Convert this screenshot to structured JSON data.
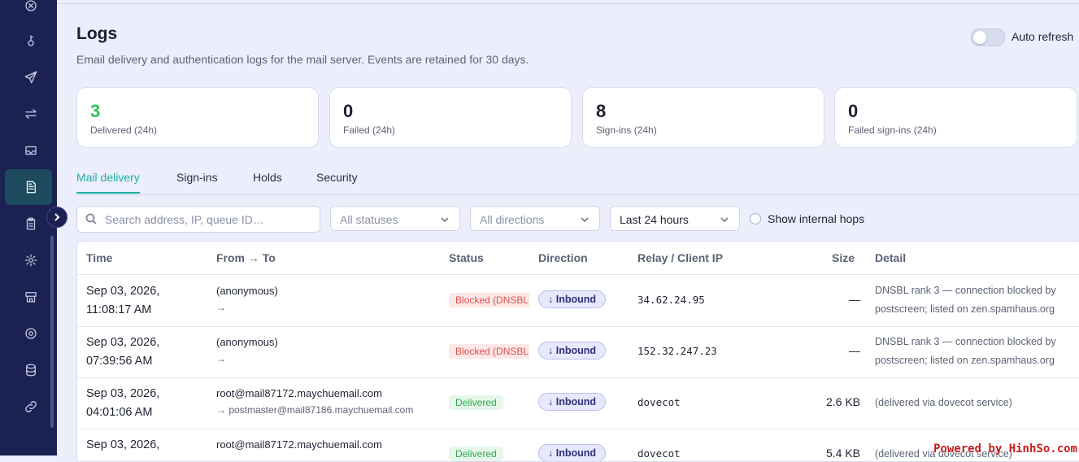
{
  "sidebar": {
    "icons": [
      "close-circle-icon",
      "key-icon",
      "send-icon",
      "swap-arrows-icon",
      "inbox-tray-icon",
      "document-icon",
      "clipboard-icon",
      "gear-icon",
      "store-icon",
      "settings-cog-icon",
      "database-icon",
      "link-icon"
    ],
    "active": "document-icon"
  },
  "header": {
    "title": "Logs",
    "subtitle": "Email delivery and authentication logs for the mail server. Events are retained for 30 days.",
    "auto_refresh_label": "Auto refresh",
    "auto_refresh_on": false
  },
  "stats": [
    {
      "value": "3",
      "label": "Delivered (24h)",
      "color": "#2fbf5b"
    },
    {
      "value": "0",
      "label": "Failed (24h)"
    },
    {
      "value": "8",
      "label": "Sign-ins (24h)"
    },
    {
      "value": "0",
      "label": "Failed sign-ins (24h)"
    }
  ],
  "tabs": [
    {
      "label": "Mail delivery",
      "active": true
    },
    {
      "label": "Sign-ins"
    },
    {
      "label": "Holds"
    },
    {
      "label": "Security"
    }
  ],
  "filters": {
    "search_placeholder": "Search address, IP, queue ID…",
    "status": "All statuses",
    "direction": "All directions",
    "range": "Last 24 hours",
    "show_internal_hops": "Show internal hops"
  },
  "table": {
    "columns": [
      "Time",
      "From → To",
      "Status",
      "Direction",
      "Relay / Client IP",
      "Size",
      "Detail"
    ],
    "rows": [
      {
        "date": "Sep 03, 2026,",
        "time": "11:08:17 AM",
        "from": "(anonymous)",
        "to": "→",
        "status": "Blocked (DNSBL",
        "direction": "↓ Inbound",
        "relay": "34.62.24.95",
        "size": "—",
        "detail": "DNSBL rank 3 — connection blocked by postscreen; listed on zen.spamhaus.org"
      },
      {
        "date": "Sep 03, 2026,",
        "time": "07:39:56 AM",
        "from": "(anonymous)",
        "to": "→",
        "status": "Blocked (DNSBL",
        "direction": "↓ Inbound",
        "relay": "152.32.247.23",
        "size": "—",
        "detail": "DNSBL rank 3 — connection blocked by postscreen; listed on zen.spamhaus.org"
      },
      {
        "date": "Sep 03, 2026,",
        "time": "04:01:06 AM",
        "from": "root@mail87172.maychuemail.com",
        "to": "→ postmaster@mail87186.maychuemail.com",
        "status": "Delivered",
        "direction": "↓ Inbound",
        "relay": "dovecot",
        "size": "2.6 KB",
        "detail": "(delivered via dovecot service)"
      },
      {
        "date": "Sep 03, 2026,",
        "time": "",
        "from": "root@mail87172.maychuemail.com",
        "to": "",
        "status": "Delivered",
        "direction": "↓ Inbound",
        "relay": "dovecot",
        "size": "5.4 KB",
        "detail": "(delivered via dovecot service)"
      }
    ]
  },
  "watermark": "Powered by HinhSo.com"
}
